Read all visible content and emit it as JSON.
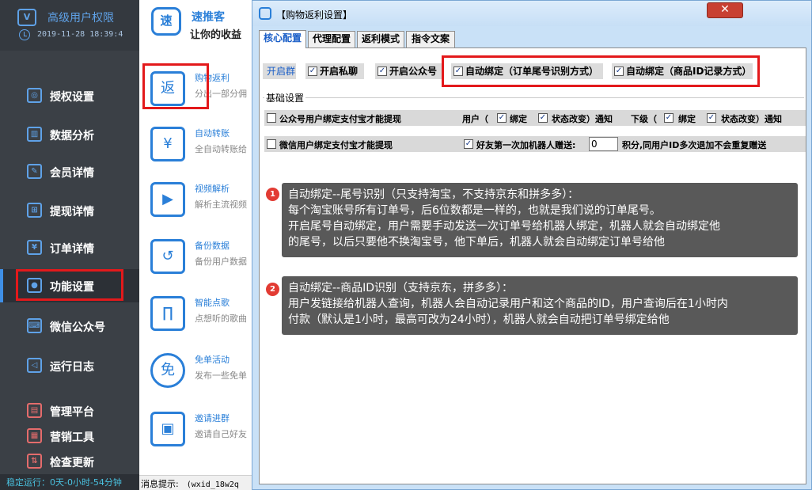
{
  "app": {
    "title": "高级用户权限",
    "logo_text": "V",
    "timestamp": "2019-11-28 18:39:4",
    "run_status": "稳定运行：0天-0小时-54分钟"
  },
  "sidebar": {
    "items": [
      {
        "label": "授权设置",
        "icon": "globe-icon",
        "glyph": "◎"
      },
      {
        "label": "数据分析",
        "icon": "chart-icon",
        "glyph": "▥"
      },
      {
        "label": "会员详情",
        "icon": "edit-icon",
        "glyph": "✎"
      },
      {
        "label": "提现详情",
        "icon": "search-doc-icon",
        "glyph": "⊞"
      },
      {
        "label": "订单详情",
        "icon": "order-icon",
        "glyph": "¥"
      },
      {
        "label": "功能设置",
        "icon": "wechat-icon",
        "glyph": "●"
      },
      {
        "label": "微信公众号",
        "icon": "keyboard-icon",
        "glyph": "⌨"
      },
      {
        "label": "运行日志",
        "icon": "speaker-icon",
        "glyph": "◁"
      },
      {
        "label": "管理平台",
        "icon": "platform-icon",
        "glyph": "▤"
      },
      {
        "label": "营销工具",
        "icon": "bars-icon",
        "glyph": "▦"
      },
      {
        "label": "检查更新",
        "icon": "update-icon",
        "glyph": "⇅"
      }
    ]
  },
  "middle": {
    "brand_glyph": "速",
    "brand_name": "速推客",
    "brand_slogan": "让你的收益",
    "features": [
      {
        "title": "购物返利",
        "desc": "分出一部分佣",
        "glyph": "返",
        "icon": "rebate-icon"
      },
      {
        "title": "自动转账",
        "desc": "全自动转账给",
        "glyph": "¥",
        "icon": "transfer-icon"
      },
      {
        "title": "视频解析",
        "desc": "解析主流视频",
        "glyph": "▶",
        "icon": "video-icon"
      },
      {
        "title": "备份数据",
        "desc": "备份用户数据",
        "glyph": "↺",
        "icon": "backup-icon"
      },
      {
        "title": "智能点歌",
        "desc": "点想听的歌曲",
        "glyph": "∏",
        "icon": "music-icon"
      },
      {
        "title": "免单活动",
        "desc": "发布一些免单",
        "glyph": "免",
        "icon": "free-icon"
      },
      {
        "title": "邀请进群",
        "desc": "邀请自己好友",
        "glyph": "▣",
        "icon": "qrcode-icon"
      }
    ],
    "status_label": "消息提示:",
    "status_value": "(wxid_18w2q"
  },
  "dialog": {
    "title": "【购物返利设置】",
    "tabs": [
      "核心配置",
      "代理配置",
      "返利模式",
      "指令文案"
    ],
    "active_tab": 0,
    "group_button": "开启群",
    "switches": [
      {
        "label": "开启私聊",
        "checked": true
      },
      {
        "label": "开启公众号",
        "checked": true
      },
      {
        "label": "自动绑定（订单尾号识别方式）",
        "checked": true
      },
      {
        "label": "自动绑定（商品ID记录方式）",
        "checked": true
      }
    ],
    "basic": {
      "title": "基础设置",
      "opt_gzh": "公众号用户绑定支付宝才能提现",
      "user_prefix": "用户（",
      "bind_label": "绑定",
      "state_label": "状态改变）通知",
      "sub_prefix": "下级（",
      "sub_bind_label": "绑定",
      "sub_state_label": "状态改变）通知",
      "opt_wx": "微信用户绑定支付宝才能提现",
      "opt_gift": "好友第一次加机器人赠送:",
      "gift_value": "0",
      "gift_suffix": "积分,同用户ID多次退加不会重复赠送"
    },
    "notes": [
      {
        "num": "1",
        "lines": [
          "自动绑定--尾号识别（只支持淘宝，不支持京东和拼多多）：",
          "每个淘宝账号所有订单号，后6位数都是一样的，也就是我们说的订单尾号。",
          "开启尾号自动绑定，用户需要手动发送一次订单号给机器人绑定，机器人就会自动绑定他",
          "的尾号，以后只要他不换淘宝号，他下单后，机器人就会自动绑定订单号给他"
        ]
      },
      {
        "num": "2",
        "lines": [
          "自动绑定--商品ID识别（支持京东，拼多多）：",
          "用户发链接给机器人查询，机器人会自动记录用户和这个商品的ID，用户查询后在1小时内",
          "付款（默认是1小时，最高可改为24小时），机器人就会自动把订单号绑定给他"
        ]
      }
    ]
  },
  "colors": {
    "sidebar_bg": "#3b4046",
    "accent_blue": "#2a7fd8",
    "highlight_red": "#e3191b",
    "dialog_bg": "#c9e1f7",
    "note_bg": "#595959",
    "badge_red": "#e23b33"
  }
}
